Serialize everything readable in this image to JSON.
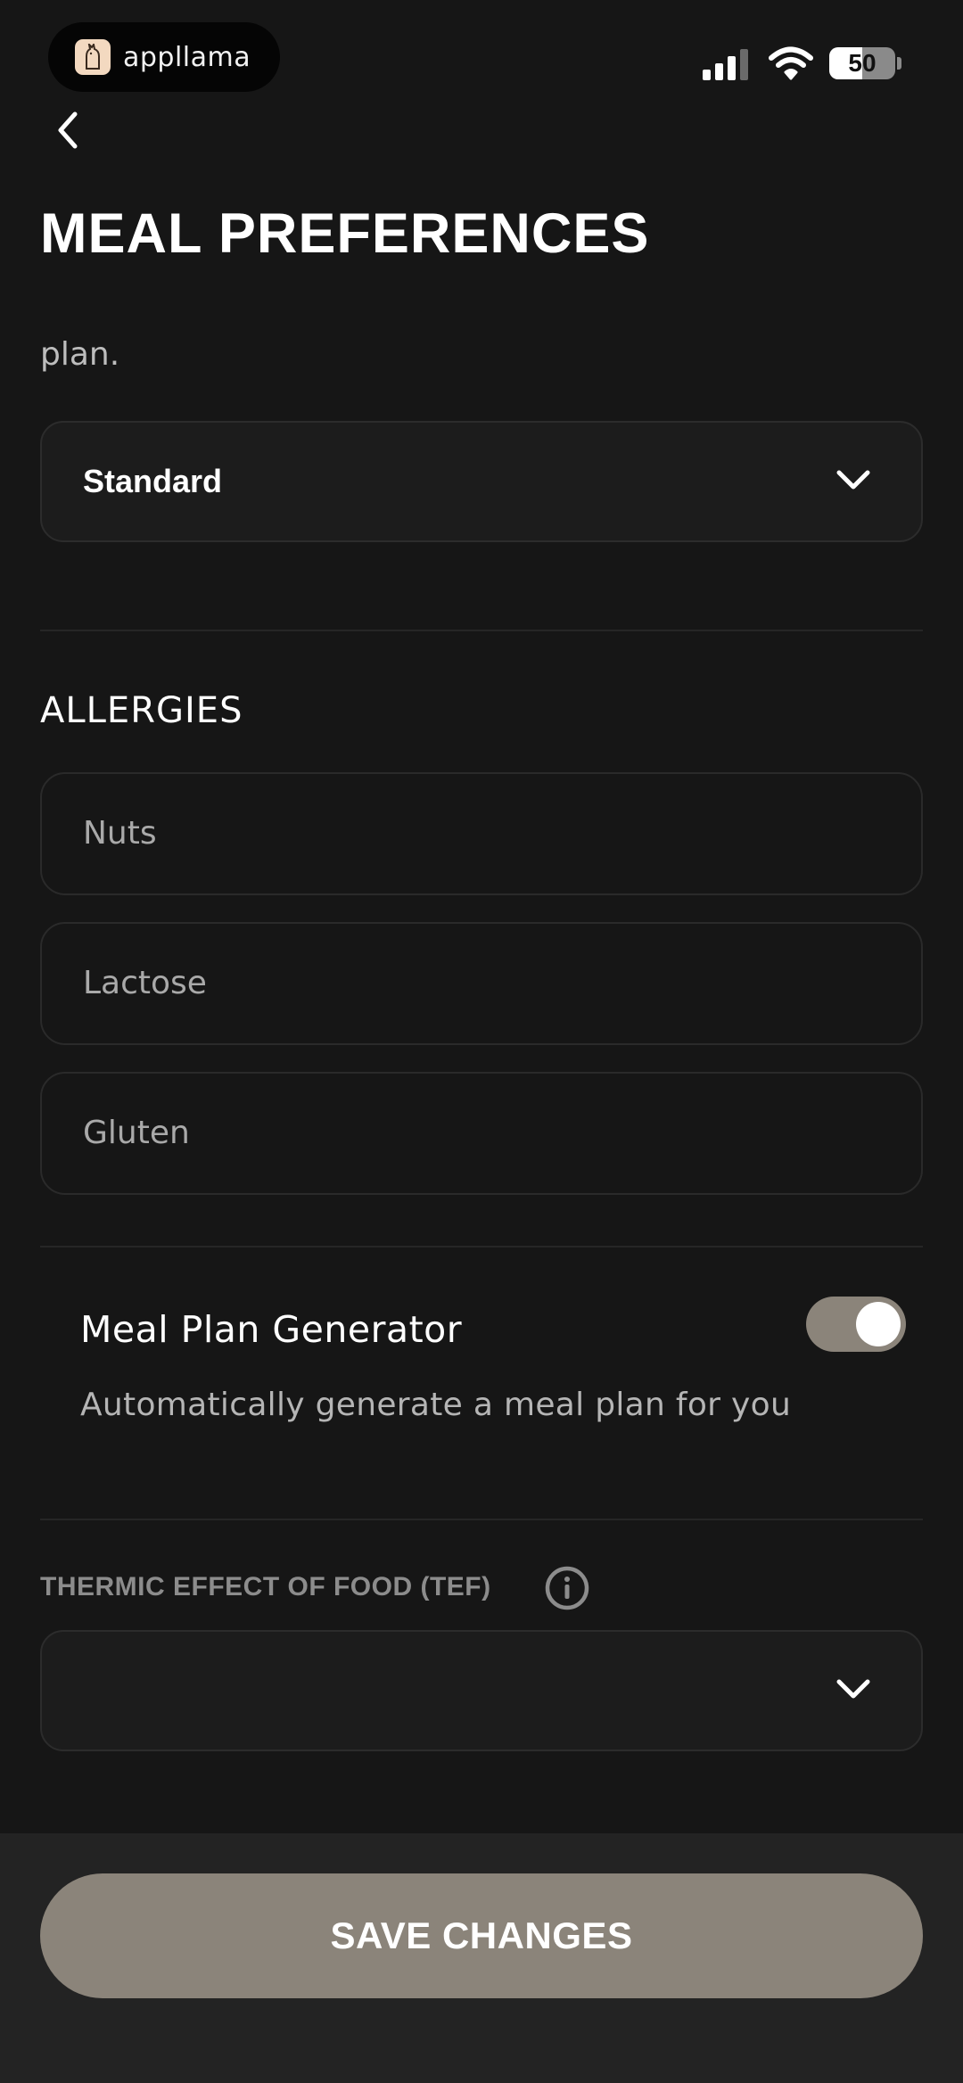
{
  "status_bar": {
    "app_name": "appllama",
    "battery_level": "50",
    "battery_fraction": 0.5
  },
  "header": {
    "title": "MEAL PREFERENCES"
  },
  "diet": {
    "description_tail": "plan.",
    "selected": "Standard"
  },
  "allergies": {
    "title": "ALLERGIES",
    "items": [
      "Nuts",
      "Lactose",
      "Gluten"
    ]
  },
  "meal_plan_generator": {
    "label": "Meal Plan Generator",
    "description": "Automatically generate a meal plan for you",
    "enabled": true
  },
  "tef": {
    "label": "THERMIC EFFECT OF FOOD (TEF)",
    "selected": ""
  },
  "footer": {
    "save_label": "SAVE CHANGES"
  },
  "colors": {
    "background": "#161616",
    "accent": "#8b847a",
    "footer_background": "#232323"
  },
  "icons": [
    "llama-logo-icon",
    "signal-icon",
    "wifi-icon",
    "battery-icon",
    "back-chevron-icon",
    "chevron-down-icon",
    "info-icon"
  ]
}
